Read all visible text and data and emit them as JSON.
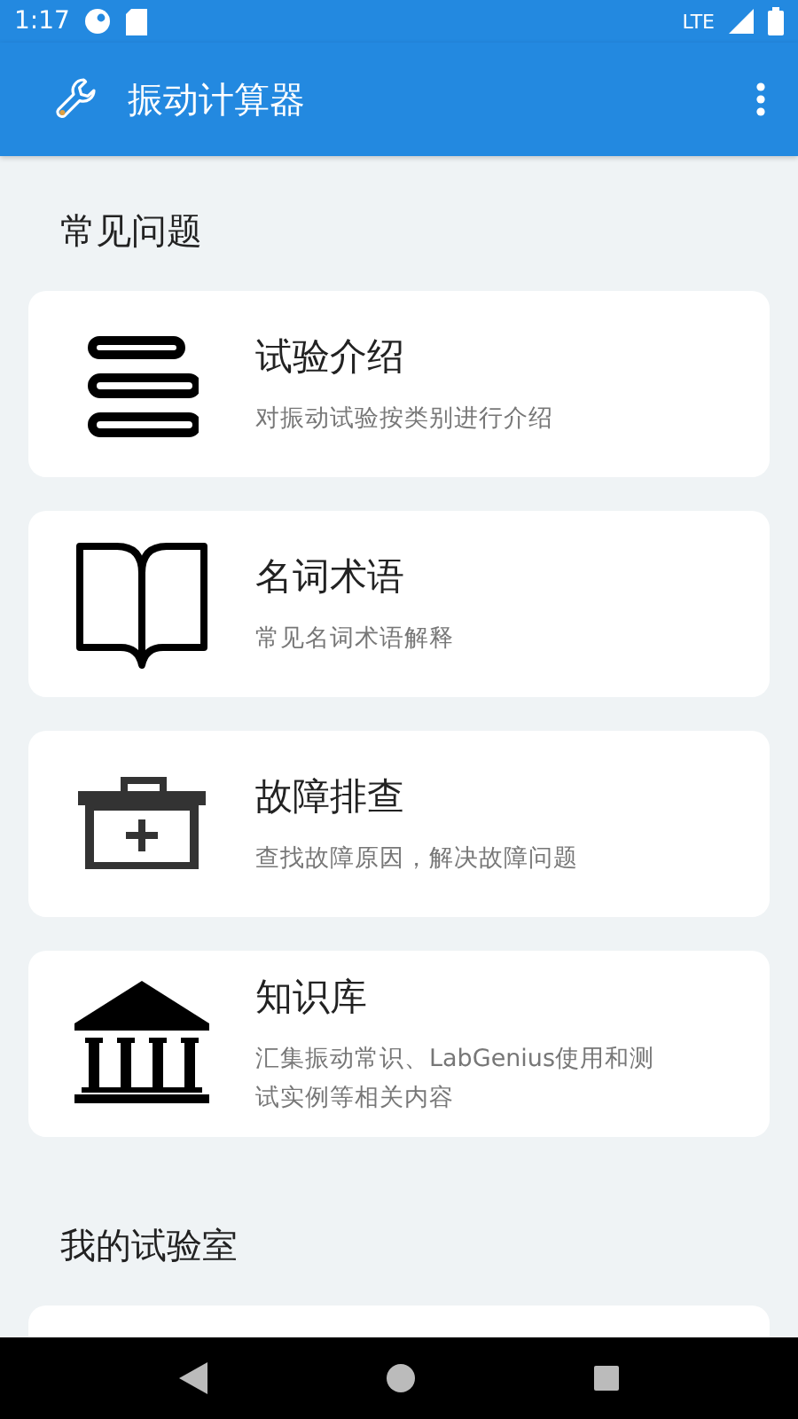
{
  "status_bar": {
    "time": "1:17",
    "network": "LTE"
  },
  "app_bar": {
    "title": "振动计算器"
  },
  "sections": [
    {
      "title": "常见问题",
      "cards": [
        {
          "title": "试验介绍",
          "description": "对振动试验按类别进行介绍"
        },
        {
          "title": "名词术语",
          "description": "常见名词术语解释"
        },
        {
          "title": "故障排查",
          "description": "查找故障原因，解决故障问题"
        },
        {
          "title": "知识库",
          "description": "汇集振动常识、LabGenius使用和测试实例等相关内容"
        }
      ]
    },
    {
      "title": "我的试验室"
    }
  ]
}
